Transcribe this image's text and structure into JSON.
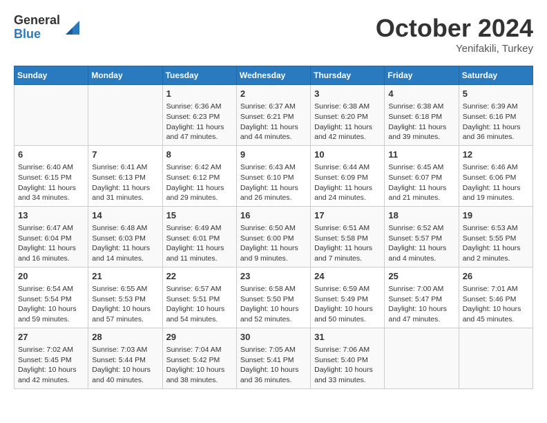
{
  "header": {
    "logo_general": "General",
    "logo_blue": "Blue",
    "month_title": "October 2024",
    "subtitle": "Yenifakili, Turkey"
  },
  "days_of_week": [
    "Sunday",
    "Monday",
    "Tuesday",
    "Wednesday",
    "Thursday",
    "Friday",
    "Saturday"
  ],
  "weeks": [
    [
      {
        "day": "",
        "info": ""
      },
      {
        "day": "",
        "info": ""
      },
      {
        "day": "1",
        "sunrise": "6:36 AM",
        "sunset": "6:23 PM",
        "daylight": "11 hours and 47 minutes."
      },
      {
        "day": "2",
        "sunrise": "6:37 AM",
        "sunset": "6:21 PM",
        "daylight": "11 hours and 44 minutes."
      },
      {
        "day": "3",
        "sunrise": "6:38 AM",
        "sunset": "6:20 PM",
        "daylight": "11 hours and 42 minutes."
      },
      {
        "day": "4",
        "sunrise": "6:38 AM",
        "sunset": "6:18 PM",
        "daylight": "11 hours and 39 minutes."
      },
      {
        "day": "5",
        "sunrise": "6:39 AM",
        "sunset": "6:16 PM",
        "daylight": "11 hours and 36 minutes."
      }
    ],
    [
      {
        "day": "6",
        "sunrise": "6:40 AM",
        "sunset": "6:15 PM",
        "daylight": "11 hours and 34 minutes."
      },
      {
        "day": "7",
        "sunrise": "6:41 AM",
        "sunset": "6:13 PM",
        "daylight": "11 hours and 31 minutes."
      },
      {
        "day": "8",
        "sunrise": "6:42 AM",
        "sunset": "6:12 PM",
        "daylight": "11 hours and 29 minutes."
      },
      {
        "day": "9",
        "sunrise": "6:43 AM",
        "sunset": "6:10 PM",
        "daylight": "11 hours and 26 minutes."
      },
      {
        "day": "10",
        "sunrise": "6:44 AM",
        "sunset": "6:09 PM",
        "daylight": "11 hours and 24 minutes."
      },
      {
        "day": "11",
        "sunrise": "6:45 AM",
        "sunset": "6:07 PM",
        "daylight": "11 hours and 21 minutes."
      },
      {
        "day": "12",
        "sunrise": "6:46 AM",
        "sunset": "6:06 PM",
        "daylight": "11 hours and 19 minutes."
      }
    ],
    [
      {
        "day": "13",
        "sunrise": "6:47 AM",
        "sunset": "6:04 PM",
        "daylight": "11 hours and 16 minutes."
      },
      {
        "day": "14",
        "sunrise": "6:48 AM",
        "sunset": "6:03 PM",
        "daylight": "11 hours and 14 minutes."
      },
      {
        "day": "15",
        "sunrise": "6:49 AM",
        "sunset": "6:01 PM",
        "daylight": "11 hours and 11 minutes."
      },
      {
        "day": "16",
        "sunrise": "6:50 AM",
        "sunset": "6:00 PM",
        "daylight": "11 hours and 9 minutes."
      },
      {
        "day": "17",
        "sunrise": "6:51 AM",
        "sunset": "5:58 PM",
        "daylight": "11 hours and 7 minutes."
      },
      {
        "day": "18",
        "sunrise": "6:52 AM",
        "sunset": "5:57 PM",
        "daylight": "11 hours and 4 minutes."
      },
      {
        "day": "19",
        "sunrise": "6:53 AM",
        "sunset": "5:55 PM",
        "daylight": "11 hours and 2 minutes."
      }
    ],
    [
      {
        "day": "20",
        "sunrise": "6:54 AM",
        "sunset": "5:54 PM",
        "daylight": "10 hours and 59 minutes."
      },
      {
        "day": "21",
        "sunrise": "6:55 AM",
        "sunset": "5:53 PM",
        "daylight": "10 hours and 57 minutes."
      },
      {
        "day": "22",
        "sunrise": "6:57 AM",
        "sunset": "5:51 PM",
        "daylight": "10 hours and 54 minutes."
      },
      {
        "day": "23",
        "sunrise": "6:58 AM",
        "sunset": "5:50 PM",
        "daylight": "10 hours and 52 minutes."
      },
      {
        "day": "24",
        "sunrise": "6:59 AM",
        "sunset": "5:49 PM",
        "daylight": "10 hours and 50 minutes."
      },
      {
        "day": "25",
        "sunrise": "7:00 AM",
        "sunset": "5:47 PM",
        "daylight": "10 hours and 47 minutes."
      },
      {
        "day": "26",
        "sunrise": "7:01 AM",
        "sunset": "5:46 PM",
        "daylight": "10 hours and 45 minutes."
      }
    ],
    [
      {
        "day": "27",
        "sunrise": "7:02 AM",
        "sunset": "5:45 PM",
        "daylight": "10 hours and 42 minutes."
      },
      {
        "day": "28",
        "sunrise": "7:03 AM",
        "sunset": "5:44 PM",
        "daylight": "10 hours and 40 minutes."
      },
      {
        "day": "29",
        "sunrise": "7:04 AM",
        "sunset": "5:42 PM",
        "daylight": "10 hours and 38 minutes."
      },
      {
        "day": "30",
        "sunrise": "7:05 AM",
        "sunset": "5:41 PM",
        "daylight": "10 hours and 36 minutes."
      },
      {
        "day": "31",
        "sunrise": "7:06 AM",
        "sunset": "5:40 PM",
        "daylight": "10 hours and 33 minutes."
      },
      {
        "day": "",
        "info": ""
      },
      {
        "day": "",
        "info": ""
      }
    ]
  ],
  "labels": {
    "sunrise_prefix": "Sunrise:",
    "sunset_prefix": "Sunset:",
    "daylight_prefix": "Daylight:"
  }
}
